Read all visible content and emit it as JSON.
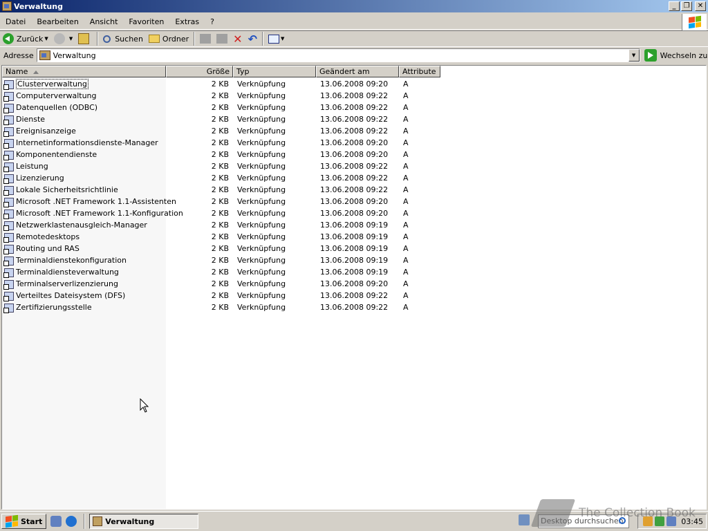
{
  "window": {
    "title": "Verwaltung"
  },
  "menu": {
    "items": [
      "Datei",
      "Bearbeiten",
      "Ansicht",
      "Favoriten",
      "Extras",
      "?"
    ]
  },
  "toolbar": {
    "back_label": "Zurück",
    "search_label": "Suchen",
    "folders_label": "Ordner"
  },
  "address": {
    "label": "Adresse",
    "value": "Verwaltung",
    "go_label": "Wechseln zu"
  },
  "columns": {
    "name": "Name",
    "size": "Größe",
    "type": "Typ",
    "modified": "Geändert am",
    "attributes": "Attribute"
  },
  "files": [
    {
      "name": "Clusterverwaltung",
      "size": "2 KB",
      "type": "Verknüpfung",
      "modified": "13.06.2008 09:20",
      "attr": "A"
    },
    {
      "name": "Computerverwaltung",
      "size": "2 KB",
      "type": "Verknüpfung",
      "modified": "13.06.2008 09:22",
      "attr": "A"
    },
    {
      "name": "Datenquellen (ODBC)",
      "size": "2 KB",
      "type": "Verknüpfung",
      "modified": "13.06.2008 09:22",
      "attr": "A"
    },
    {
      "name": "Dienste",
      "size": "2 KB",
      "type": "Verknüpfung",
      "modified": "13.06.2008 09:22",
      "attr": "A"
    },
    {
      "name": "Ereignisanzeige",
      "size": "2 KB",
      "type": "Verknüpfung",
      "modified": "13.06.2008 09:22",
      "attr": "A"
    },
    {
      "name": "Internetinformationsdienste-Manager",
      "size": "2 KB",
      "type": "Verknüpfung",
      "modified": "13.06.2008 09:20",
      "attr": "A"
    },
    {
      "name": "Komponentendienste",
      "size": "2 KB",
      "type": "Verknüpfung",
      "modified": "13.06.2008 09:20",
      "attr": "A"
    },
    {
      "name": "Leistung",
      "size": "2 KB",
      "type": "Verknüpfung",
      "modified": "13.06.2008 09:22",
      "attr": "A"
    },
    {
      "name": "Lizenzierung",
      "size": "2 KB",
      "type": "Verknüpfung",
      "modified": "13.06.2008 09:22",
      "attr": "A"
    },
    {
      "name": "Lokale Sicherheitsrichtlinie",
      "size": "2 KB",
      "type": "Verknüpfung",
      "modified": "13.06.2008 09:22",
      "attr": "A"
    },
    {
      "name": "Microsoft .NET Framework 1.1-Assistenten",
      "size": "2 KB",
      "type": "Verknüpfung",
      "modified": "13.06.2008 09:20",
      "attr": "A"
    },
    {
      "name": "Microsoft .NET Framework 1.1-Konfiguration",
      "size": "2 KB",
      "type": "Verknüpfung",
      "modified": "13.06.2008 09:20",
      "attr": "A"
    },
    {
      "name": "Netzwerklastenausgleich-Manager",
      "size": "2 KB",
      "type": "Verknüpfung",
      "modified": "13.06.2008 09:19",
      "attr": "A"
    },
    {
      "name": "Remotedesktops",
      "size": "2 KB",
      "type": "Verknüpfung",
      "modified": "13.06.2008 09:19",
      "attr": "A"
    },
    {
      "name": "Routing und RAS",
      "size": "2 KB",
      "type": "Verknüpfung",
      "modified": "13.06.2008 09:19",
      "attr": "A"
    },
    {
      "name": "Terminaldienstekonfiguration",
      "size": "2 KB",
      "type": "Verknüpfung",
      "modified": "13.06.2008 09:19",
      "attr": "A"
    },
    {
      "name": "Terminaldiensteverwaltung",
      "size": "2 KB",
      "type": "Verknüpfung",
      "modified": "13.06.2008 09:19",
      "attr": "A"
    },
    {
      "name": "Terminalserverlizenzierung",
      "size": "2 KB",
      "type": "Verknüpfung",
      "modified": "13.06.2008 09:20",
      "attr": "A"
    },
    {
      "name": "Verteiltes Dateisystem (DFS)",
      "size": "2 KB",
      "type": "Verknüpfung",
      "modified": "13.06.2008 09:22",
      "attr": "A"
    },
    {
      "name": "Zertifizierungsstelle",
      "size": "2 KB",
      "type": "Verknüpfung",
      "modified": "13.06.2008 09:22",
      "attr": "A"
    }
  ],
  "taskbar": {
    "start_label": "Start",
    "task_label": "Verwaltung",
    "search_placeholder": "Desktop durchsuchen",
    "clock": "03:45"
  },
  "watermark": {
    "text": "The Collection Book"
  },
  "icons": [
    "back-icon",
    "forward-icon",
    "up-folder-icon",
    "search-icon",
    "folders-icon",
    "move-to-icon",
    "copy-to-icon",
    "delete-icon",
    "undo-icon",
    "views-icon",
    "go-icon",
    "windows-logo-icon"
  ],
  "colors": {
    "titlebar_start": "#0a246a",
    "titlebar_end": "#a6caf0",
    "chrome": "#d4d0c8"
  }
}
